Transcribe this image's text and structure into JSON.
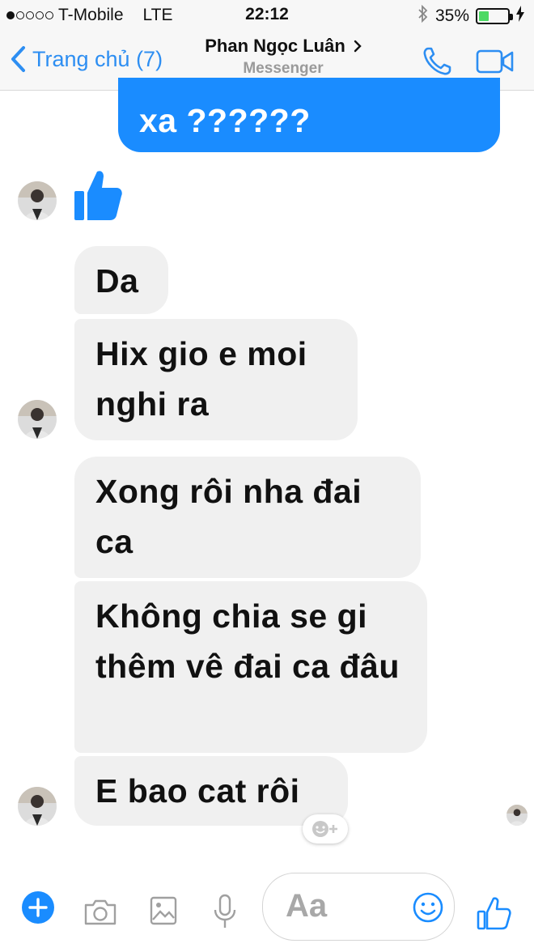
{
  "status_bar": {
    "carrier": "T-Mobile",
    "network": "LTE",
    "time": "22:12",
    "battery": "35%",
    "battery_level": 0.35
  },
  "nav": {
    "back_label": "Trang chủ (7)",
    "contact_name": "Phan Ngọc Luân",
    "subtitle": "Messenger"
  },
  "messages": {
    "outgoing_1": "xa ??????",
    "incoming": [
      "Da",
      "Hix gio e moi nghi ra",
      "Xong rôi nha đai ca",
      "Không chia se gi thêm vê đai ca đâu",
      "E bao cat rôi"
    ]
  },
  "composer": {
    "placeholder": "Aa"
  },
  "colors": {
    "accent": "#2d8ef2",
    "outgoing_bubble": "#1a8cff",
    "incoming_bubble": "#f0f0f0"
  }
}
